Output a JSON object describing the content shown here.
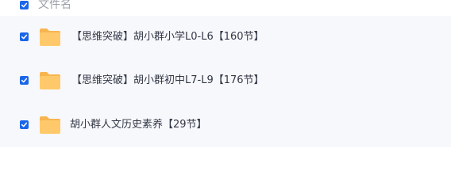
{
  "header": {
    "column_label": "文件名",
    "select_all_checked": true
  },
  "files": [
    {
      "name": "【思维突破】胡小群小学L0-L6【160节】",
      "type": "folder",
      "checked": true
    },
    {
      "name": "【思维突破】胡小群初中L7-L9【176节】",
      "type": "folder",
      "checked": true
    },
    {
      "name": "胡小群人文历史素养【29节】",
      "type": "folder",
      "checked": true
    }
  ],
  "colors": {
    "checkbox": "#1a66e8",
    "folder": "#ffc96b",
    "row_background": "#f7f8fc",
    "text": "#333845",
    "header_text": "#9aa0a8"
  },
  "icons": {
    "folder": "folder-icon",
    "checkbox": "checkbox-checked-icon"
  }
}
